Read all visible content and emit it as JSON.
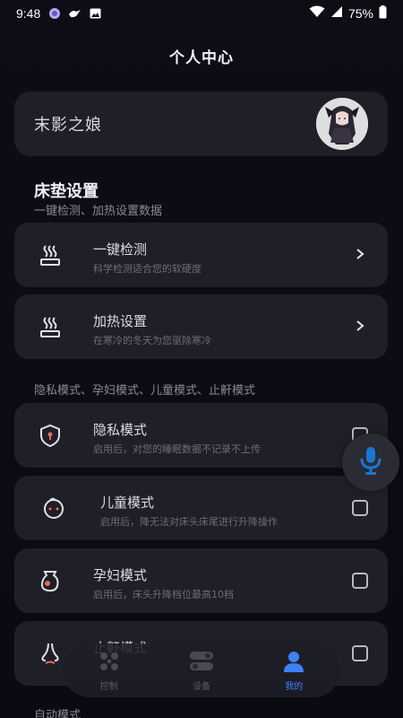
{
  "status_bar": {
    "time": "9:48",
    "battery": "75%",
    "icons": [
      "app-icon",
      "bird-icon",
      "image-icon",
      "wifi-icon",
      "signal-icon",
      "battery-icon"
    ]
  },
  "page": {
    "title": "个人中心"
  },
  "profile": {
    "name": "末影之娘",
    "avatar": "avatar-image"
  },
  "mattress": {
    "title": "床垫设置",
    "subtitle": "一键检测、加热设置数据",
    "items": [
      {
        "label": "一键检测",
        "desc": "科学检测适合您的软硬度",
        "icon": "heat-waves-icon"
      },
      {
        "label": "加热设置",
        "desc": "在寒冷的冬天为您驱除寒冷",
        "icon": "heat-waves-icon"
      }
    ]
  },
  "modes": {
    "subtitle": "隐私模式、孕妇模式、儿童模式、止鼾模式",
    "items": [
      {
        "label": "隐私模式",
        "desc": "启用后，对您的睡眠数据不记录不上传",
        "icon": "shield-lock-icon",
        "checked": false
      },
      {
        "label": "儿童模式",
        "desc": "启用后，降无法对床头床尾进行升降操作",
        "icon": "child-face-icon",
        "checked": false
      },
      {
        "label": "孕妇模式",
        "desc": "启用后，床头升降档位最高10档",
        "icon": "pregnant-icon",
        "checked": false
      },
      {
        "label": "止鼾模式",
        "desc": "",
        "icon": "nose-icon",
        "checked": false
      }
    ]
  },
  "bottom_section": {
    "title": "自动模式"
  },
  "nav": {
    "items": [
      {
        "label": "控制",
        "icon": "grid-icon",
        "active": false
      },
      {
        "label": "设备",
        "icon": "devices-icon",
        "active": false
      },
      {
        "label": "我的",
        "icon": "user-icon",
        "active": true
      }
    ]
  },
  "colors": {
    "accent": "#3b82f6",
    "card": "#1f1f28",
    "background": "#0b0b14",
    "icon_red": "#e56a5a"
  }
}
